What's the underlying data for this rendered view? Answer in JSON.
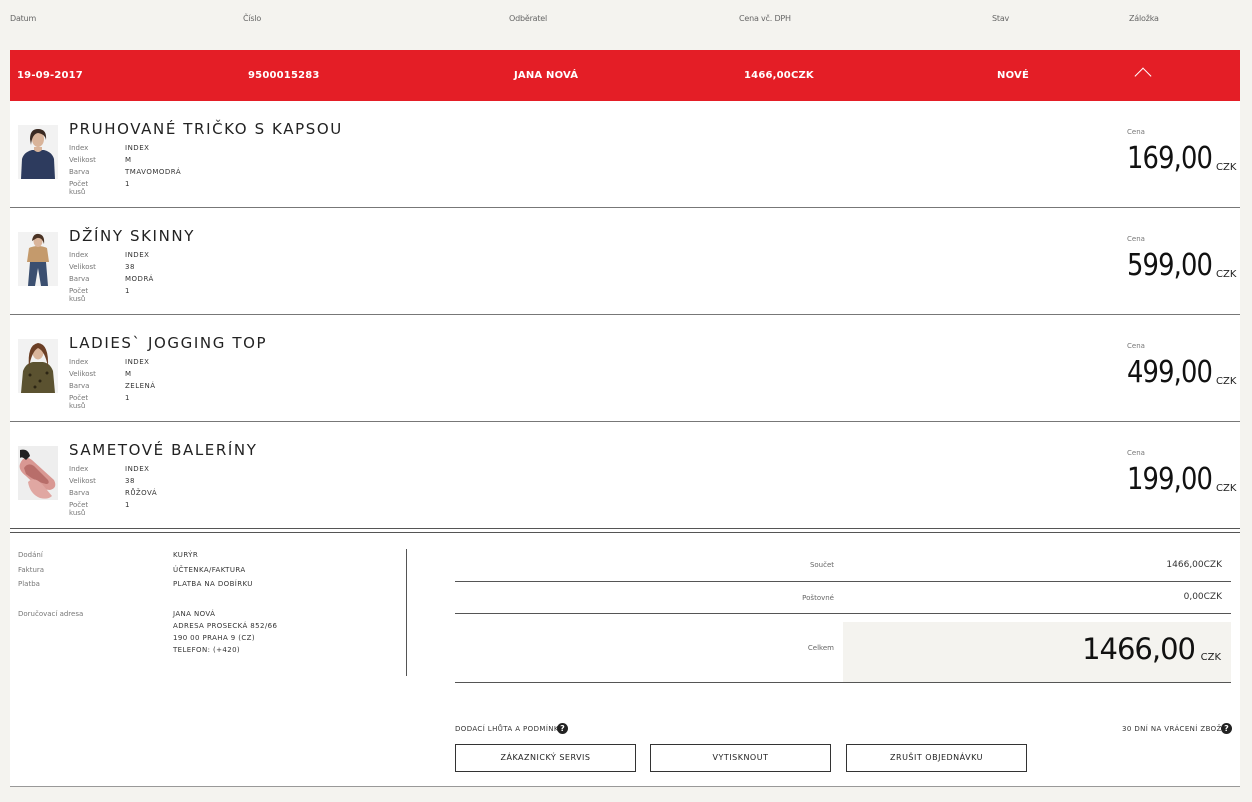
{
  "header": {
    "date": "Datum",
    "number": "Číslo",
    "recipient": "Odběratel",
    "price_vat": "Cena vč. DPH",
    "status": "Stav",
    "tab": "Záložka"
  },
  "order": {
    "date": "19-09-2017",
    "number": "9500015283",
    "recipient": "JANA NOVÁ",
    "price": "1466,00CZK",
    "status": "NOVÉ",
    "accent": "#e41e26"
  },
  "attr_labels": {
    "index": "Index",
    "size": "Velikost",
    "color": "Barva",
    "count": "Počet kusů",
    "price": "Cena"
  },
  "items": [
    {
      "name": "PRUHOVANÉ TRIČKO S KAPSOU",
      "index": "INDEX",
      "size": "M",
      "color": "TMAVOMODRÁ",
      "count": "1",
      "price": "169,00",
      "currency": "CZK"
    },
    {
      "name": "DŽÍNY SKINNY",
      "index": "INDEX",
      "size": "38",
      "color": "MODRÁ",
      "count": "1",
      "price": "599,00",
      "currency": "CZK"
    },
    {
      "name": "LADIES` JOGGING TOP",
      "index": "INDEX",
      "size": "M",
      "color": "ZELENÁ",
      "count": "1",
      "price": "499,00",
      "currency": "CZK"
    },
    {
      "name": "SAMETOVÉ BALERÍNY",
      "index": "INDEX",
      "size": "38",
      "color": "RŮŽOVÁ",
      "count": "1",
      "price": "199,00",
      "currency": "CZK"
    }
  ],
  "info": {
    "delivery_label": "Dodání",
    "delivery": "KURÝR",
    "invoice_label": "Faktura",
    "invoice": "ÚČTENKA/FAKTURA",
    "payment_label": "Platba",
    "payment": "PLATBA NA DOBÍRKU",
    "address_label": "Doručovací adresa",
    "address_name": "JANA NOVÁ",
    "address_street": "ADRESA PROSECKÁ 852/66",
    "address_city": "190 00 PRAHA 9 (CZ)",
    "address_phone": "TELEFON: (+420)"
  },
  "totals": {
    "subtotal_label": "Součet",
    "subtotal": "1466,00CZK",
    "shipping_label": "Poštovné",
    "shipping": "0,00CZK",
    "total_label": "Celkem",
    "total": "1466,00",
    "total_currency": "CZK"
  },
  "links": {
    "delivery_terms": "DODACÍ LHŮTA A PODMÍNKY",
    "returns": "30 DNÍ NA VRÁCENÍ ZBOŽÍ",
    "help_glyph": "?"
  },
  "buttons": {
    "customer_service": "ZÁKAZNICKÝ SERVIS",
    "print": "VYTISKNOUT",
    "cancel": "ZRUŠIT OBJEDNÁVKU"
  }
}
